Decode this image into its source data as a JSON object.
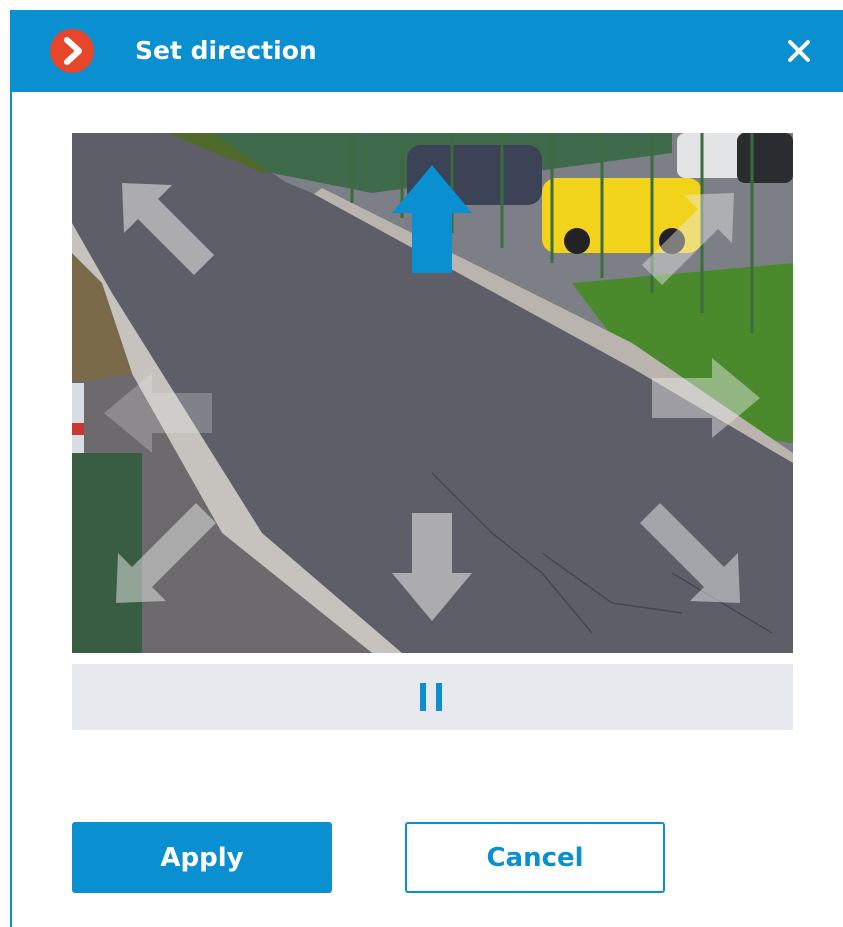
{
  "dialog": {
    "title": "Set direction",
    "close_icon": "close-icon",
    "app_icon": "app-logo-icon"
  },
  "preview": {
    "image_description_icons": [
      "arrow-up-left-icon",
      "arrow-up-icon",
      "arrow-up-right-icon",
      "arrow-right-icon",
      "arrow-down-right-icon",
      "arrow-down-icon",
      "arrow-down-left-icon",
      "arrow-left-icon"
    ],
    "selected_direction": "up"
  },
  "playback": {
    "pause_icon": "pause-icon"
  },
  "buttons": {
    "apply_label": "Apply",
    "cancel_label": "Cancel"
  },
  "colors": {
    "accent": "#0a8fd0",
    "logo": "#e8462b",
    "selected_arrow": "#0a8fd0",
    "unselected_arrow": "rgba(235,235,235,0.55)"
  }
}
